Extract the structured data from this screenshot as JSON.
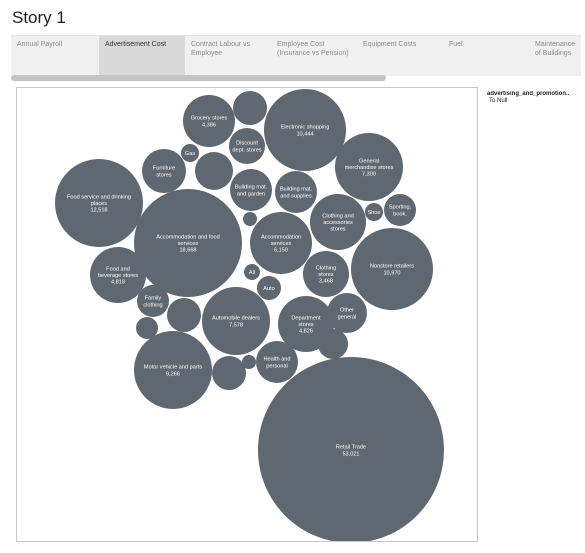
{
  "story": {
    "title": "Story 1",
    "active_index": 1,
    "points": [
      "Annual Payroll",
      "Advertisement Cost",
      "Contract Labour vs Employee",
      "Employee Cost (Insurance vs Pension)",
      "Equipment Costs",
      "Fuel",
      "Maintenance of Buildings"
    ]
  },
  "legend": {
    "title": "advertising_and_promotion..",
    "value": "To Null"
  },
  "colors": {
    "bubble": "#5f6770",
    "active_tab": "#d9d9d9",
    "tab_bar": "#f0f0f0"
  },
  "chart_data": {
    "type": "bubble",
    "bubbles": [
      {
        "label": "Grocery stores",
        "value": "4,386"
      },
      {
        "label": "",
        "value": ""
      },
      {
        "label": "Electronic shopping",
        "value": "10,444"
      },
      {
        "label": "Discount dept. stores",
        "value": ""
      },
      {
        "label": "Gas",
        "value": ""
      },
      {
        "label": "Furniture stores",
        "value": ""
      },
      {
        "label": "",
        "value": ""
      },
      {
        "label": "General merchandise stores",
        "value": "7,300"
      },
      {
        "label": "Food service and drinking places",
        "value": "12,518"
      },
      {
        "label": "Building mat. and garden",
        "value": ""
      },
      {
        "label": "Building mat. and supplies",
        "value": ""
      },
      {
        "label": "Shoe",
        "value": ""
      },
      {
        "label": "Sporting, book,",
        "value": ""
      },
      {
        "label": "Clothing and accessories stores",
        "value": ""
      },
      {
        "label": "",
        "value": ""
      },
      {
        "label": "Accommodation and food services",
        "value": "18,668"
      },
      {
        "label": "Accommodation services",
        "value": "6,150"
      },
      {
        "label": "Nonstore retailers",
        "value": "10,970"
      },
      {
        "label": "Food and beverage stores",
        "value": "4,818"
      },
      {
        "label": "All",
        "value": ""
      },
      {
        "label": "Clothing stores",
        "value": "3,468"
      },
      {
        "label": "Auto",
        "value": ""
      },
      {
        "label": "Family clothing",
        "value": ""
      },
      {
        "label": "",
        "value": ""
      },
      {
        "label": "Automobile dealers",
        "value": "7,578"
      },
      {
        "label": "Department stores",
        "value": "4,826"
      },
      {
        "label": "Other general",
        "value": ""
      },
      {
        "label": "",
        "value": ""
      },
      {
        "label": "",
        "value": ""
      },
      {
        "label": "Motor vehicle and parts",
        "value": "9,266"
      },
      {
        "label": "",
        "value": ""
      },
      {
        "label": "",
        "value": ""
      },
      {
        "label": "Health and personal",
        "value": ""
      },
      {
        "label": "Retail Trade",
        "value": "53,021"
      }
    ]
  }
}
